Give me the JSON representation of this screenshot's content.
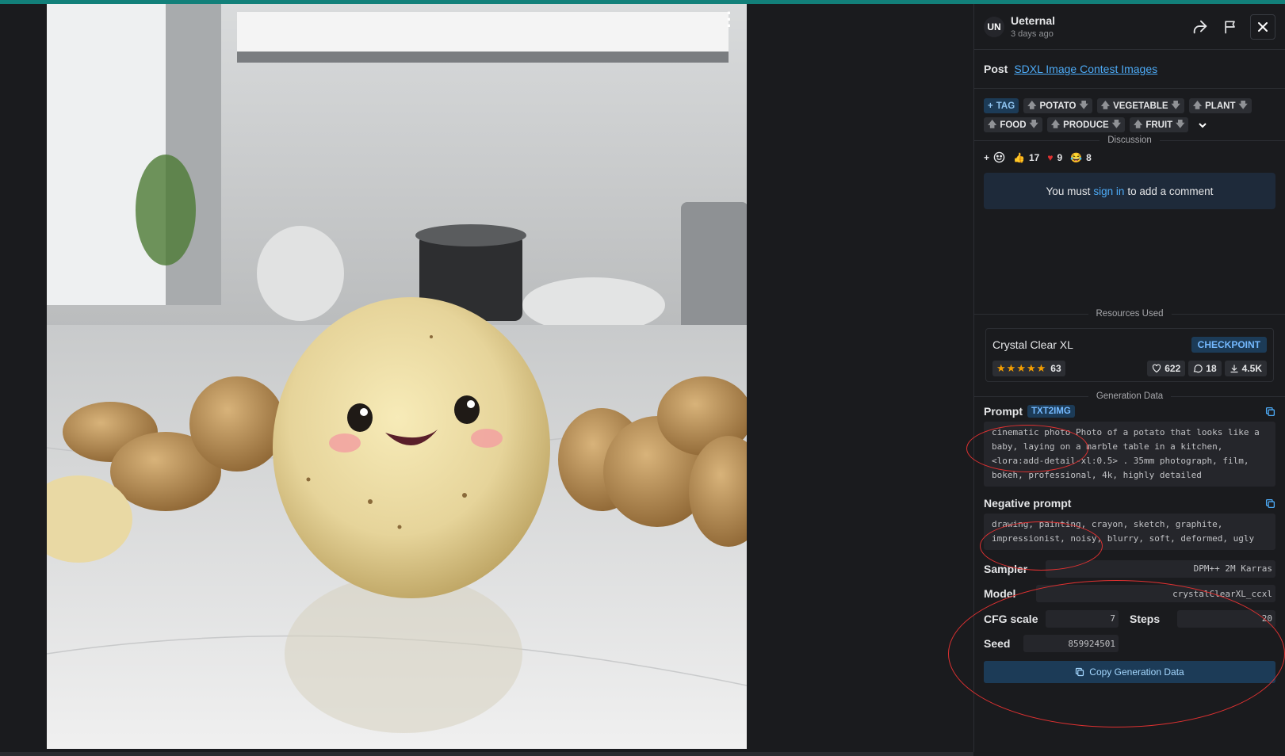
{
  "header": {
    "avatar_initials": "UN",
    "username": "Ueternal",
    "posted": "3 days ago"
  },
  "post": {
    "label": "Post",
    "link_text": "SDXL Image Contest Images"
  },
  "tags": {
    "add_label": "TAG",
    "items": [
      "POTATO",
      "VEGETABLE",
      "PLANT",
      "FOOD",
      "PRODUCE",
      "FRUIT"
    ]
  },
  "discussion": {
    "title": "Discussion",
    "reactions": [
      {
        "icon": "thumbs-up",
        "count": "17"
      },
      {
        "icon": "heart",
        "count": "9"
      },
      {
        "icon": "laugh",
        "count": "8"
      }
    ],
    "signin_prefix": "You must",
    "signin_link": "sign in",
    "signin_suffix": "to add a comment"
  },
  "resources": {
    "title": "Resources Used",
    "name": "Crystal Clear XL",
    "badge": "CHECKPOINT",
    "rating_count": "63",
    "likes": "622",
    "comments": "18",
    "downloads": "4.5K"
  },
  "generation": {
    "title": "Generation Data",
    "prompt_label": "Prompt",
    "prompt_badge": "TXT2IMG",
    "prompt_text": "cinematic photo Photo of a potato that looks like a baby, laying on a marble table in a kitchen, <lora:add-detail-xl:0.5> . 35mm photograph, film, bokeh, professional, 4k, highly detailed",
    "negative_label": "Negative prompt",
    "negative_text": "drawing, painting, crayon, sketch, graphite, impressionist, noisy, blurry, soft, deformed, ugly",
    "sampler_label": "Sampler",
    "sampler_value": "DPM++ 2M Karras",
    "model_label": "Model",
    "model_value": "crystalClearXL_ccxl",
    "cfg_label": "CFG scale",
    "cfg_value": "7",
    "steps_label": "Steps",
    "steps_value": "20",
    "seed_label": "Seed",
    "seed_value": "859924501",
    "copy_button": "Copy Generation Data"
  },
  "colors": {
    "accent": "#4dabf7",
    "annotation": "#e03131",
    "top_bar": "#12807a"
  }
}
